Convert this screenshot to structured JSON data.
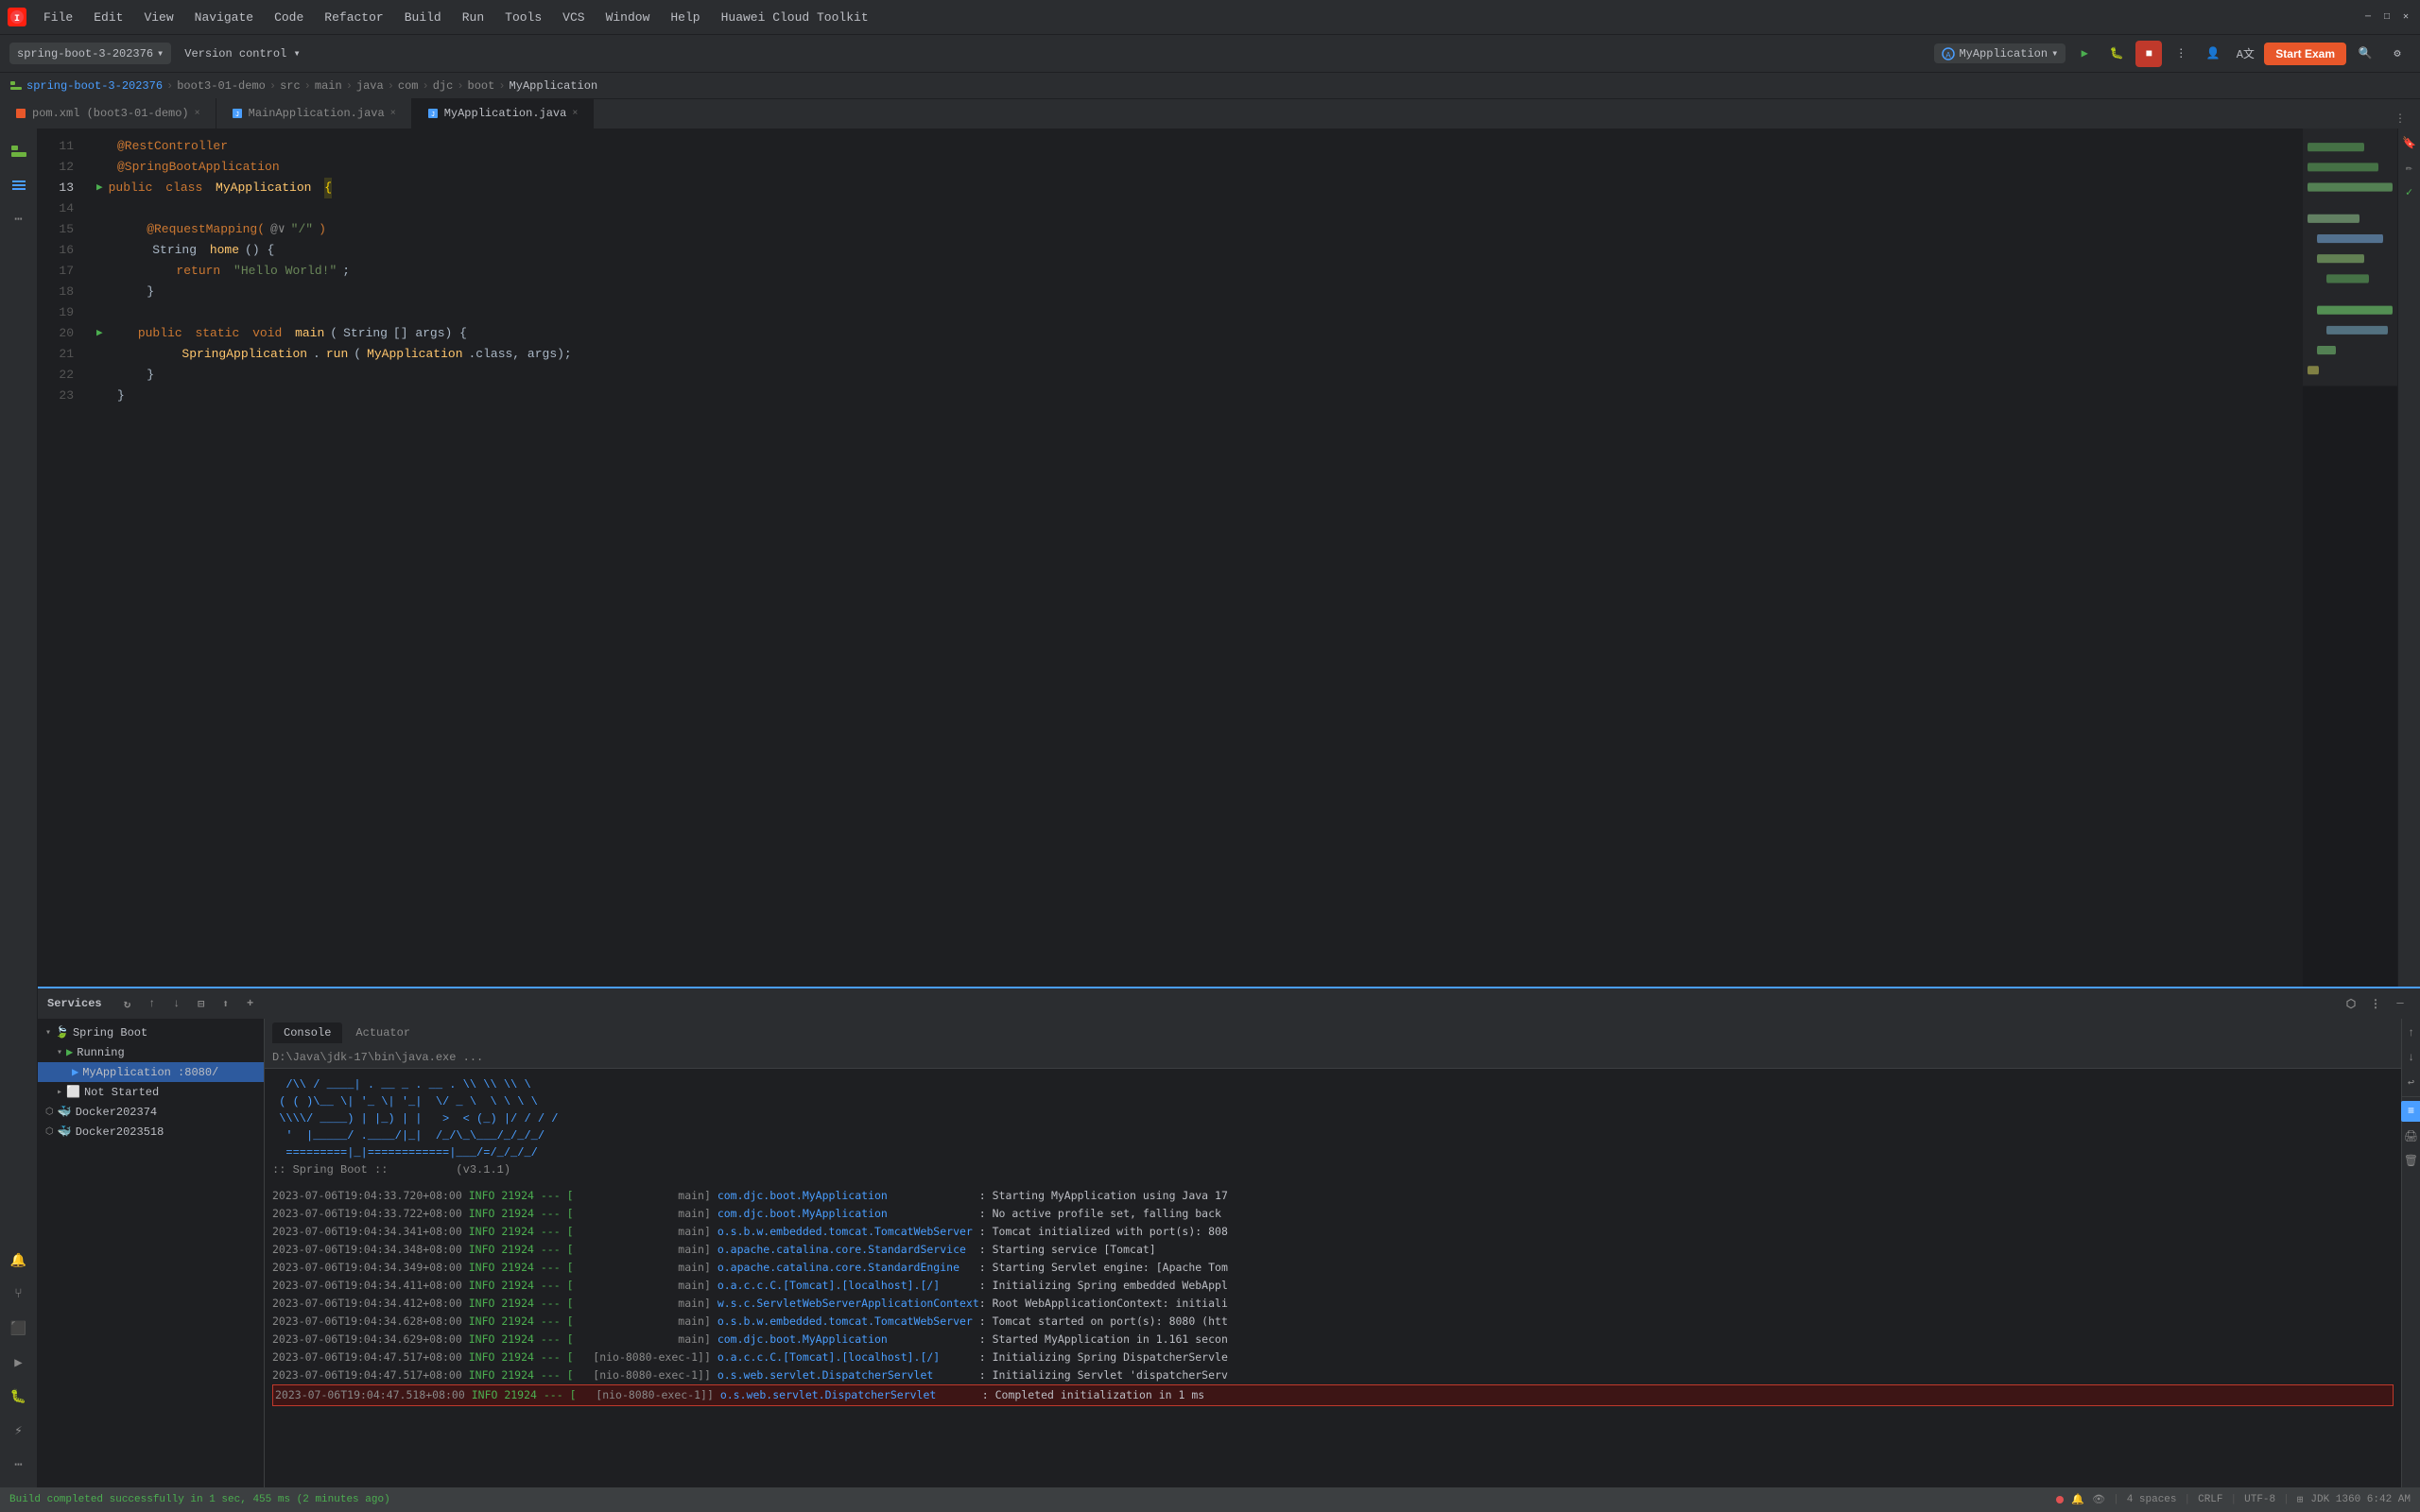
{
  "titlebar": {
    "app_icon": "I",
    "menus": [
      "File",
      "Edit",
      "View",
      "Navigate",
      "Code",
      "Refactor",
      "Build",
      "Run",
      "Tools",
      "VCS",
      "Window",
      "Help",
      "Huawei Cloud Toolkit"
    ],
    "window_title": "",
    "win_minimize": "─",
    "win_maximize": "□",
    "win_close": "✕"
  },
  "toolbar": {
    "project": "spring-boot-3-202376",
    "vcs": "Version control",
    "run_config": "MyApplication",
    "start_exam": "Start Exam"
  },
  "breadcrumb": {
    "parts": [
      "spring-boot-3-202376",
      "boot3-01-demo",
      "src",
      "main",
      "java",
      "com",
      "djc",
      "boot",
      "MyApplication"
    ]
  },
  "tabs": [
    {
      "label": "pom.xml (boot3-01-demo)",
      "active": false
    },
    {
      "label": "MainApplication.java",
      "active": false
    },
    {
      "label": "MyApplication.java",
      "active": true
    }
  ],
  "code_lines": [
    {
      "num": 11,
      "content": "@RestController",
      "type": "annotation"
    },
    {
      "num": 12,
      "content": "@SpringBootApplication",
      "type": "annotation"
    },
    {
      "num": 13,
      "content": "public class MyApplication {",
      "type": "class_decl",
      "has_run": true
    },
    {
      "num": 14,
      "content": "",
      "type": "empty"
    },
    {
      "num": 15,
      "content": "    @RequestMapping(@∨\"/\")",
      "type": "annotation"
    },
    {
      "num": 16,
      "content": "    String home() {",
      "type": "code"
    },
    {
      "num": 17,
      "content": "        return \"Hello World!\";",
      "type": "code"
    },
    {
      "num": 18,
      "content": "    }",
      "type": "code"
    },
    {
      "num": 19,
      "content": "",
      "type": "empty"
    },
    {
      "num": 20,
      "content": "    public static void main(String[] args) {",
      "type": "code",
      "has_run": true
    },
    {
      "num": 21,
      "content": "        SpringApplication.run(MyApplication.class, args);",
      "type": "code"
    },
    {
      "num": 22,
      "content": "    }",
      "type": "code"
    },
    {
      "num": 23,
      "content": "}",
      "type": "code_end"
    }
  ],
  "services": {
    "title": "Services",
    "tree": [
      {
        "label": "Spring Boot",
        "level": 0,
        "icon": "spring",
        "expanded": true
      },
      {
        "label": "Running",
        "level": 1,
        "icon": "run",
        "expanded": true
      },
      {
        "label": "MyApplication :8080/",
        "level": 2,
        "icon": "app",
        "selected": true
      },
      {
        "label": "Not Started",
        "level": 1,
        "icon": "stop",
        "expanded": true
      },
      {
        "label": "Docker202374",
        "level": 0,
        "icon": "docker"
      },
      {
        "label": "Docker2023518",
        "level": 0,
        "icon": "docker"
      }
    ]
  },
  "console": {
    "tabs": [
      "Console",
      "Actuator"
    ],
    "active_tab": "Console",
    "path": "D:\\Java\\jdk-17\\bin\\java.exe ...",
    "ascii_art": [
      "  /\\\\  / ____| . __   _ . __  . \\\\ \\\\ \\\\ \\\\",
      " ( ( )\\\\__ \\\\| '_ \\ | '__| \\ \\/ _ \\ \\ \\ \\ \\\\",
      " \\\\\\\\/ ____) | |_) || |    >  < (_) | / / / /",
      "  '  |_____/ .____/ |_|   /_/\\_\\___/_/_/_/",
      "  =========|_|============|___/=/_/_/_/"
    ],
    "spring_version": ":: Spring Boot ::          (v3.1.1)",
    "log_lines": [
      {
        "ts": "2023-07-06T19:04:33.720+08:00",
        "level": "INFO",
        "pid": "21924",
        "thread": "main",
        "class": "com.djc.boot.MyApplication",
        "msg": ": Starting MyApplication using Java 17"
      },
      {
        "ts": "2023-07-06T19:04:33.722+08:00",
        "level": "INFO",
        "pid": "21924",
        "thread": "main",
        "class": "com.djc.boot.MyApplication",
        "msg": ": No active profile set, falling back"
      },
      {
        "ts": "2023-07-06T19:04:34.341+08:00",
        "level": "INFO",
        "pid": "21924",
        "thread": "main",
        "class": "o.s.b.w.embedded.tomcat.TomcatWebServer",
        "msg": ": Tomcat initialized with port(s): 808"
      },
      {
        "ts": "2023-07-06T19:04:34.348+08:00",
        "level": "INFO",
        "pid": "21924",
        "thread": "main",
        "class": "o.apache.catalina.core.StandardService",
        "msg": ": Starting service [Tomcat]"
      },
      {
        "ts": "2023-07-06T19:04:34.349+08:00",
        "level": "INFO",
        "pid": "21924",
        "thread": "main",
        "class": "o.apache.catalina.core.StandardEngine",
        "msg": ": Starting Servlet engine: [Apache Tom"
      },
      {
        "ts": "2023-07-06T19:04:34.411+08:00",
        "level": "INFO",
        "pid": "21924",
        "thread": "main",
        "class": "o.a.c.c.C.[Tomcat].[localhost].[/]",
        "msg": ": Initializing Spring embedded WebAppl"
      },
      {
        "ts": "2023-07-06T19:04:34.412+08:00",
        "level": "INFO",
        "pid": "21924",
        "thread": "main",
        "class": "w.s.c.ServletWebServerApplicationContext",
        "msg": ": Root WebApplicationContext: initiali"
      },
      {
        "ts": "2023-07-06T19:04:34.628+08:00",
        "level": "INFO",
        "pid": "21924",
        "thread": "main",
        "class": "o.s.b.w.embedded.tomcat.TomcatWebServer",
        "msg": ": Tomcat started on port(s): 8080 (htt"
      },
      {
        "ts": "2023-07-06T19:04:34.629+08:00",
        "level": "INFO",
        "pid": "21924",
        "thread": "main",
        "class": "com.djc.boot.MyApplication",
        "msg": ": Started MyApplication in 1.161 secon"
      },
      {
        "ts": "2023-07-06T19:04:47.517+08:00",
        "level": "INFO",
        "pid": "21924",
        "thread": "[nio-8080-exec-1]",
        "class": "o.a.c.c.C.[Tomcat].[localhost].[/]",
        "msg": ": Initializing Spring DispatcherServle"
      },
      {
        "ts": "2023-07-06T19:04:47.517+08:00",
        "level": "INFO",
        "pid": "21924",
        "thread": "[nio-8080-exec-1]",
        "class": "o.s.web.servlet.DispatcherServlet",
        "msg": ": Initializing Servlet 'dispatcherServ"
      },
      {
        "ts": "2023-07-06T19:04:47.518+08:00",
        "level": "INFO",
        "pid": "21924",
        "thread": "[nio-8080-exec-1]",
        "class": "o.s.web.servlet.DispatcherServlet",
        "msg": ": Completed initialization in 1 ms",
        "highlighted": true
      }
    ]
  },
  "statusbar": {
    "build_msg": "Build completed successfully in 1 sec, 455 ms (2 minutes ago)",
    "indent": "4 spaces",
    "encoding": "CRLF",
    "charset": "UTF-8",
    "jdk": "JDK 1360 6:42 AM"
  }
}
